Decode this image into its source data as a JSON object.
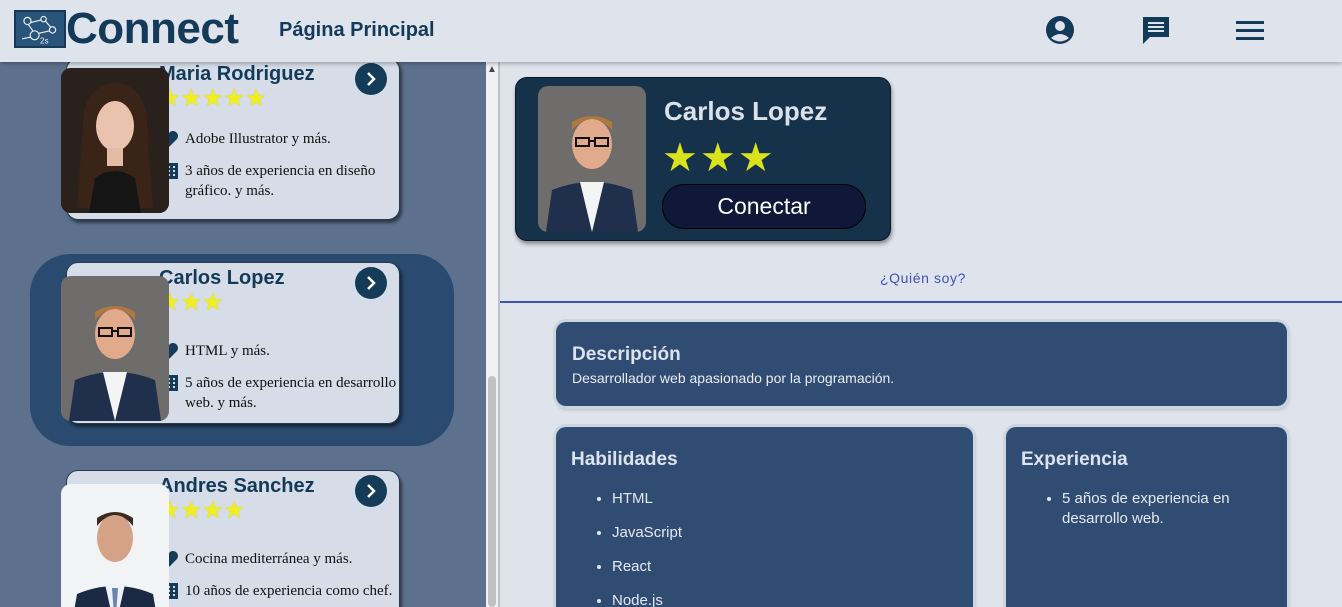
{
  "header": {
    "brand": "Connect",
    "nav_title": "Página Principal",
    "icons": [
      "account-circle-icon",
      "chat-icon",
      "menu-icon"
    ]
  },
  "sidebar": {
    "cards": [
      {
        "name": "Maria Rodriguez",
        "stars": "★★★★★",
        "rating": 5,
        "skill": "Adobe Illustrator y más.",
        "experience": "3 años de experiencia en diseño gráfico. y más."
      },
      {
        "name": "Carlos Lopez",
        "stars": "★★★",
        "rating": 3,
        "skill": "HTML y más.",
        "experience": "5 años de experiencia en desarrollo web. y más.",
        "selected": true
      },
      {
        "name": "Andres Sanchez",
        "stars": "★★★★",
        "rating": 4,
        "skill": "Cocina mediterránea y más.",
        "experience": "10 años de experiencia como chef."
      }
    ]
  },
  "profile": {
    "name": "Carlos Lopez",
    "stars": "★★★",
    "rating": 3,
    "connect_label": "Conectar"
  },
  "tab": {
    "label": "¿Quién soy?"
  },
  "description": {
    "title": "Descripción",
    "text": "Desarrollador web apasionado por la programación."
  },
  "skills": {
    "title": "Habilidades",
    "items": [
      "HTML",
      "JavaScript",
      "React",
      "Node.js"
    ]
  },
  "experience": {
    "title": "Experiencia",
    "items": [
      "5 años de experiencia en desarrollo web."
    ]
  },
  "colors": {
    "header_bg": "#dfe4ec",
    "brand": "#133a58",
    "sidebar_bg": "#5d718f",
    "selected_card_bg": "#2a4a70",
    "profile_card_bg": "#16324a",
    "panel_bg": "#314c73",
    "star": "#f2ef1e",
    "tab_accent": "#3f52b5"
  }
}
